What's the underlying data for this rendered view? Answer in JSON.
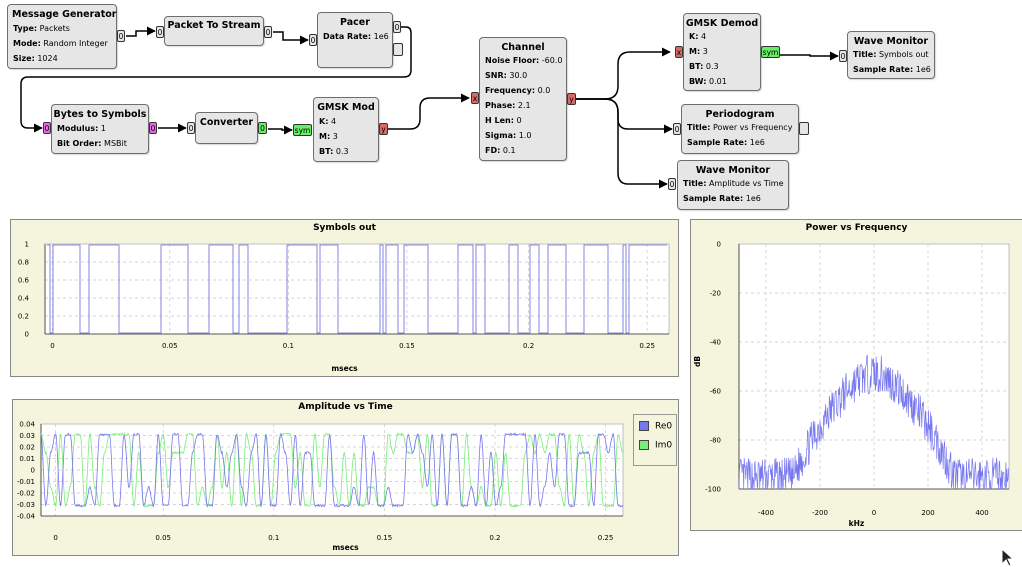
{
  "blocks": {
    "message_generator": {
      "title": "Message Generator",
      "params": [
        {
          "k": "Type:",
          "v": "Packets"
        },
        {
          "k": "Mode:",
          "v": "Random Integer"
        },
        {
          "k": "Size:",
          "v": "1024"
        }
      ]
    },
    "packet_to_stream": {
      "title": "Packet To Stream"
    },
    "pacer": {
      "title": "Pacer",
      "params": [
        {
          "k": "Data Rate:",
          "v": "1e6"
        }
      ]
    },
    "channel": {
      "title": "Channel",
      "params": [
        {
          "k": "Noise Floor:",
          "v": "-60.0"
        },
        {
          "k": "SNR:",
          "v": "30.0"
        },
        {
          "k": "Frequency:",
          "v": "0.0"
        },
        {
          "k": "Phase:",
          "v": "2.1"
        },
        {
          "k": "H Len:",
          "v": "0"
        },
        {
          "k": "Sigma:",
          "v": "1.0"
        },
        {
          "k": "FD:",
          "v": "0.1"
        }
      ]
    },
    "gmsk_demod": {
      "title": "GMSK Demod",
      "params": [
        {
          "k": "K:",
          "v": "4"
        },
        {
          "k": "M:",
          "v": "3"
        },
        {
          "k": "BT:",
          "v": "0.3"
        },
        {
          "k": "BW:",
          "v": "0.01"
        }
      ]
    },
    "wave_monitor_1": {
      "title": "Wave Monitor",
      "params": [
        {
          "k": "Title:",
          "v": "Symbols out"
        },
        {
          "k": "Sample Rate:",
          "v": "1e6"
        }
      ]
    },
    "bytes_to_symbols": {
      "title": "Bytes to Symbols",
      "params": [
        {
          "k": "Modulus:",
          "v": "1"
        },
        {
          "k": "Bit Order:",
          "v": "MSBit"
        }
      ]
    },
    "converter": {
      "title": "Converter"
    },
    "gmsk_mod": {
      "title": "GMSK Mod",
      "params": [
        {
          "k": "K:",
          "v": "4"
        },
        {
          "k": "M:",
          "v": "3"
        },
        {
          "k": "BT:",
          "v": "0.3"
        }
      ]
    },
    "periodogram": {
      "title": "Periodogram",
      "params": [
        {
          "k": "Title:",
          "v": "Power vs Frequency"
        },
        {
          "k": "Sample Rate:",
          "v": "1e6"
        }
      ]
    },
    "wave_monitor_2": {
      "title": "Wave Monitor",
      "params": [
        {
          "k": "Title:",
          "v": "Amplitude vs Time"
        },
        {
          "k": "Sample Rate:",
          "v": "1e6"
        }
      ]
    }
  },
  "ports": {
    "zero": "0",
    "x": "x",
    "y": "y",
    "sym": "sym"
  },
  "plots": {
    "symbols": {
      "title": "Symbols out",
      "xlabel": "msecs",
      "xticks": [
        "0",
        "0.05",
        "0.1",
        "0.15",
        "0.2",
        "0.25"
      ],
      "yticks": [
        "1",
        "0.8",
        "0.6",
        "0.4",
        "0.2",
        "0"
      ]
    },
    "amplitude": {
      "title": "Amplitude vs Time",
      "xlabel": "msecs",
      "xticks": [
        "0",
        "0.05",
        "0.1",
        "0.15",
        "0.2",
        "0.25"
      ],
      "yticks": [
        "0.04",
        "0.03",
        "0.02",
        "0.01",
        "0",
        "-0.01",
        "-0.02",
        "-0.03",
        "-0.04"
      ],
      "legend": [
        "Re0",
        "Im0"
      ]
    },
    "power": {
      "title": "Power vs Frequency",
      "xlabel": "kHz",
      "ylabel": "dB",
      "xticks": [
        "-400",
        "-200",
        "0",
        "200",
        "400"
      ],
      "yticks": [
        "0",
        "-20",
        "-40",
        "-60",
        "-80",
        "-100"
      ]
    }
  },
  "colors": {
    "re": "#7777ee",
    "im": "#77ee77",
    "symbols": "#6666dd",
    "psd": "#7777ee"
  }
}
